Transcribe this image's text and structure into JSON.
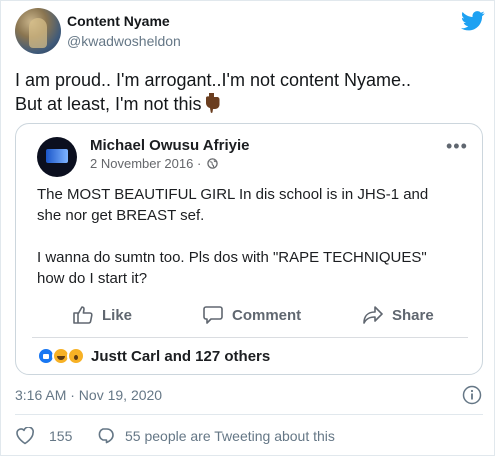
{
  "author": {
    "name": "Content Nyame",
    "handle": "@kwadwosheldon"
  },
  "tweet": {
    "line1": "I am proud.. I'm arrogant..I'm not content Nyame..",
    "line2": "But at least, I'm not this",
    "emoji": "pointing-down-icon"
  },
  "embedded_post": {
    "author": "Michael Owusu Afriyie",
    "date": "2 November 2016 ·",
    "more": "•••",
    "paragraph1_line1": "The MOST BEAUTIFUL GIRL In dis school is in JHS-1 and",
    "paragraph1_line2": "she nor get BREAST sef.",
    "paragraph2_line1": "I wanna do sumtn too. Pls dos with \"RAPE TECHNIQUES\"",
    "paragraph2_line2": "how do I start it?",
    "actions": {
      "like": "Like",
      "comment": "Comment",
      "share": "Share"
    },
    "reactions_text": "Justt Carl and 127 others"
  },
  "footer": {
    "timestamp": "3:16 AM · Nov 19, 2020",
    "like_count": "155",
    "discussion": "55 people are Tweeting about this"
  },
  "colors": {
    "twitter_blue": "#1da1f2",
    "muted_text": "#657786",
    "fb_blue": "#1877f2"
  }
}
